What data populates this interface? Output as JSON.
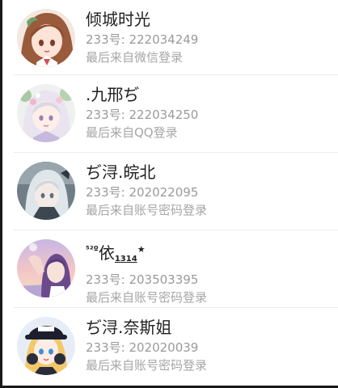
{
  "accounts": [
    {
      "name": "倾城时光",
      "uid": "233号: 222034249",
      "login_method": "最后来自微信登录",
      "avatar_icon": "anime-girl-brown-hair-avatar"
    },
    {
      "name": ".九邢ぢ",
      "uid": "233号: 222034250",
      "login_method": "最后来自QQ登录",
      "avatar_icon": "anime-girl-white-hair-flowers-avatar"
    },
    {
      "name": "ぢ浔.皖北",
      "uid": "233号: 202022095",
      "login_method": "最后来自账号密码登录",
      "avatar_icon": "anime-girl-silver-hair-avatar"
    },
    {
      "name_parts": {
        "sup": "⁵²º",
        "main": "依",
        "sub": "1314",
        "star": "★"
      },
      "uid": "233号: 203503395",
      "login_method": "最后来自账号密码登录",
      "avatar_icon": "anime-girl-sunset-avatar"
    },
    {
      "name": "ぢ浔.奈斯姐",
      "uid": "233号: 202020039",
      "login_method": "最后来自账号密码登录",
      "avatar_icon": "anime-girl-cap-headphones-avatar"
    }
  ],
  "colors": {
    "name_text": "#1f1f1f",
    "secondary_text": "#9a9a9a",
    "divider": "#ececec",
    "background": "#ffffff"
  }
}
